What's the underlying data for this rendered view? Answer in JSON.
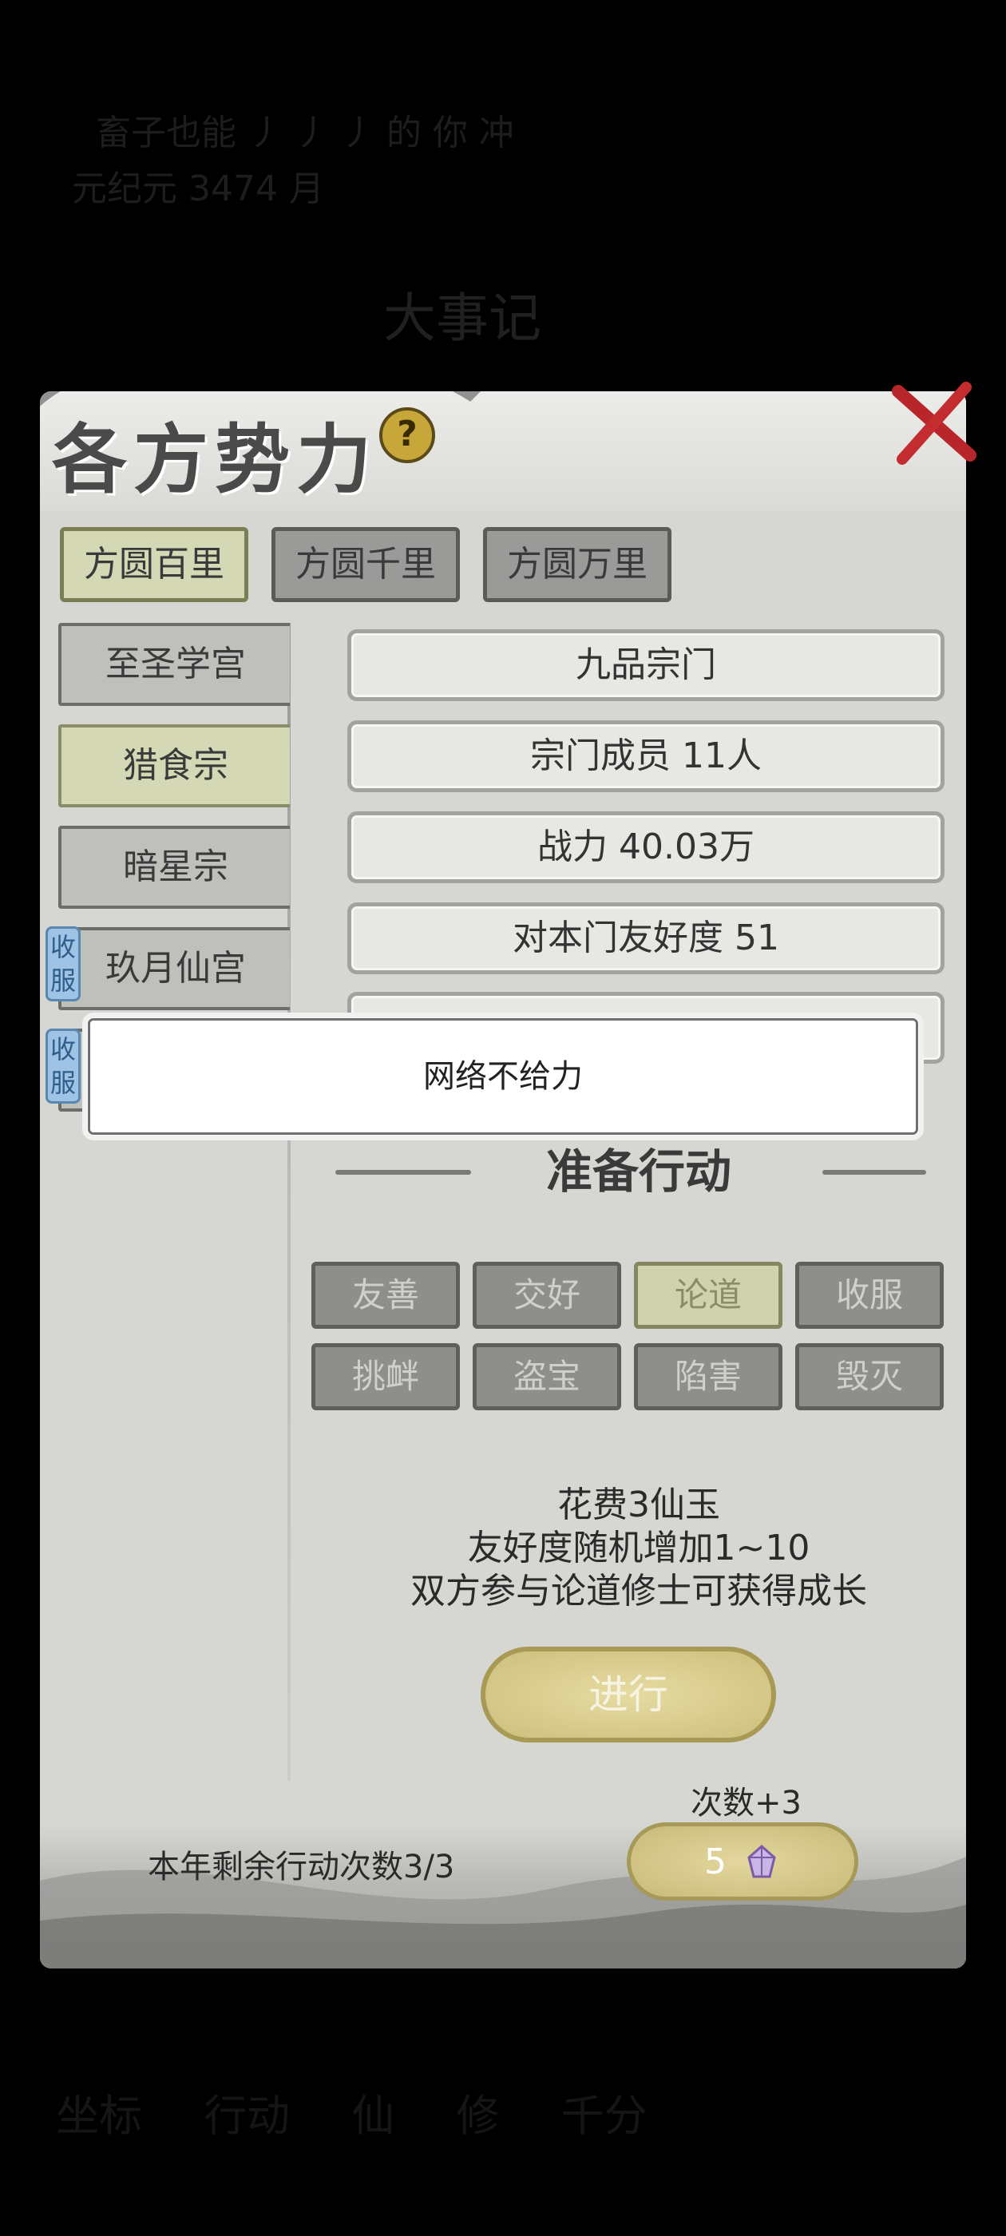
{
  "background": {
    "line1": "畜子也能 丿  丿 丿 的 你 冲 ",
    "line2": "元纪元 3474 月         ",
    "big_label": "大事记",
    "bottom_row": "坐标 行动 仙 修 千分"
  },
  "panel": {
    "title": "各方势力",
    "help_icon": "question-circle-icon",
    "close_icon": "red-x-icon"
  },
  "region_tabs": [
    {
      "label": "方圆百里",
      "active": true
    },
    {
      "label": "方圆千里",
      "active": false
    },
    {
      "label": "方圆万里",
      "active": false
    }
  ],
  "sects": [
    {
      "name": "至圣学宫",
      "active": false,
      "badge": ""
    },
    {
      "name": "猎食宗",
      "active": true,
      "badge": ""
    },
    {
      "name": "暗星宗",
      "active": false,
      "badge": ""
    },
    {
      "name": "玖月仙宫",
      "active": false,
      "badge": "收服"
    },
    {
      "name": "",
      "active": false,
      "badge": "收服"
    }
  ],
  "info": {
    "rank": "九品宗门",
    "members": "宗门成员  11人",
    "power": "战力  40.03万",
    "friendship": "对本门友好度  51"
  },
  "actions": {
    "heading": "准备行动",
    "buttons": [
      {
        "label": "友善",
        "active": false
      },
      {
        "label": "交好",
        "active": false
      },
      {
        "label": "论道",
        "active": true
      },
      {
        "label": "收服",
        "active": false
      },
      {
        "label": "挑衅",
        "active": false
      },
      {
        "label": "盗宝",
        "active": false
      },
      {
        "label": "陷害",
        "active": false
      },
      {
        "label": "毁灭",
        "active": false
      }
    ],
    "description": [
      "花费3仙玉",
      "友好度随机增加1~10",
      "双方参与论道修士可获得成长"
    ],
    "go_label": "进行"
  },
  "footer": {
    "count_label": "次数+3",
    "remaining": "本年剩余行动次数3/3",
    "cost_value": "5",
    "cost_icon": "jade-crystal-icon"
  },
  "toast": {
    "message": "网络不给力"
  },
  "colors": {
    "active_tab": "#d5d8b4",
    "gold_button": "#cdbf7c",
    "badge_blue": "#9ec3e4",
    "close_red": "#c0262a"
  }
}
